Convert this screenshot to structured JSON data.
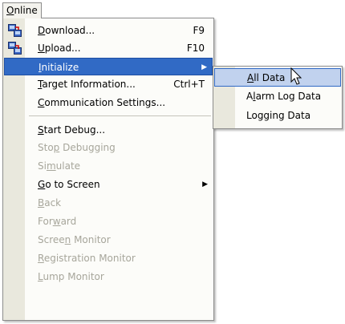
{
  "menubar": {
    "online_label": "Online"
  },
  "menu": {
    "items": [
      {
        "label": "Download...",
        "shortcut": "F9",
        "icon": "download-icon"
      },
      {
        "label": "Upload...",
        "shortcut": "F10",
        "icon": "upload-icon"
      },
      {
        "label": "Initialize",
        "submenu_arrow": "▶"
      },
      {
        "label": "Target Information...",
        "shortcut": "Ctrl+T"
      },
      {
        "label": "Communication Settings..."
      },
      {
        "label": "Start Debug..."
      },
      {
        "label": "Stop Debugging"
      },
      {
        "label": "Simulate"
      },
      {
        "label": "Go to Screen",
        "submenu_arrow": "▶"
      },
      {
        "label": "Back"
      },
      {
        "label": "Forward"
      },
      {
        "label": "Screen Monitor"
      },
      {
        "label": "Registration Monitor"
      },
      {
        "label": "Lump Monitor"
      }
    ]
  },
  "submenu": {
    "items": [
      {
        "label": "All Data"
      },
      {
        "label": "Alarm Log Data"
      },
      {
        "label": "Logging Data"
      }
    ]
  },
  "colors": {
    "highlight": "#316ac5",
    "hover": "#c1d2ee",
    "disabled_text": "#a7a69b",
    "gutter": "#e9e8dd"
  }
}
